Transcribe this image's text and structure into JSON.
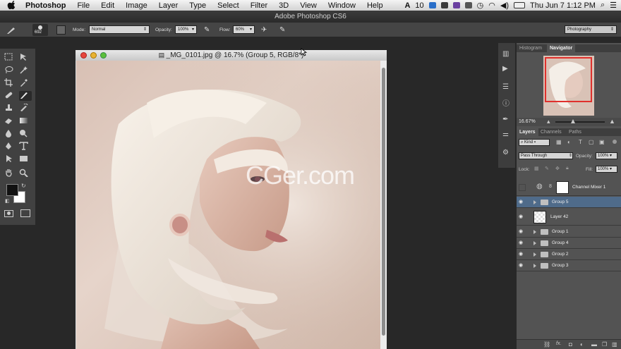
{
  "menubar": {
    "app": "Photoshop",
    "items": [
      "File",
      "Edit",
      "Image",
      "Layer",
      "Type",
      "Select",
      "Filter",
      "3D",
      "View",
      "Window",
      "Help"
    ],
    "status_num": "10",
    "clock": "Thu Jun 7  1:12 PM"
  },
  "window_title": "Adobe Photoshop CS6",
  "options_bar": {
    "brush_size": "692",
    "mode_label": "Mode:",
    "mode_value": "Normal",
    "opacity_label": "Opacity:",
    "opacity_value": "100%",
    "flow_label": "Flow:",
    "flow_value": "60%",
    "workspace": "Photography"
  },
  "document": {
    "title": "_MG_0101.jpg @ 16.7% (Group 5, RGB/8*)",
    "watermark": "CGer.com"
  },
  "navigator": {
    "tabs": [
      "Histogram",
      "Navigator"
    ],
    "active_tab": "Navigator",
    "zoom": "16.67%"
  },
  "layers_panel": {
    "tabs": [
      "Layers",
      "Channels",
      "Paths"
    ],
    "active_tab": "Layers",
    "filter": "Kind",
    "blend_mode": "Pass Through",
    "opacity_label": "Opacity:",
    "opacity_value": "100%",
    "lock_label": "Lock:",
    "fill_label": "Fill:",
    "fill_value": "100%",
    "layers": [
      {
        "name": "Channel Mixer 1",
        "type": "adjustment",
        "visible": false,
        "selected": false
      },
      {
        "name": "Group 5",
        "type": "group",
        "visible": true,
        "selected": true
      },
      {
        "name": "Layer 42",
        "type": "layer",
        "visible": true,
        "selected": false
      },
      {
        "name": "Group 1",
        "type": "group",
        "visible": true,
        "selected": false
      },
      {
        "name": "Group 4",
        "type": "group",
        "visible": true,
        "selected": false
      },
      {
        "name": "Group 2",
        "type": "group",
        "visible": true,
        "selected": false
      },
      {
        "name": "Group 3",
        "type": "group",
        "visible": true,
        "selected": false
      }
    ],
    "footer_icons": [
      "link-icon",
      "fx-icon",
      "mask-icon",
      "adjustment-icon",
      "folder-icon",
      "new-layer-icon",
      "trash-icon"
    ]
  },
  "colors": {
    "foreground": "#111111",
    "background": "#ffffff",
    "selected_row": "#4f6b8a",
    "navigator_frame": "#e0302c"
  }
}
